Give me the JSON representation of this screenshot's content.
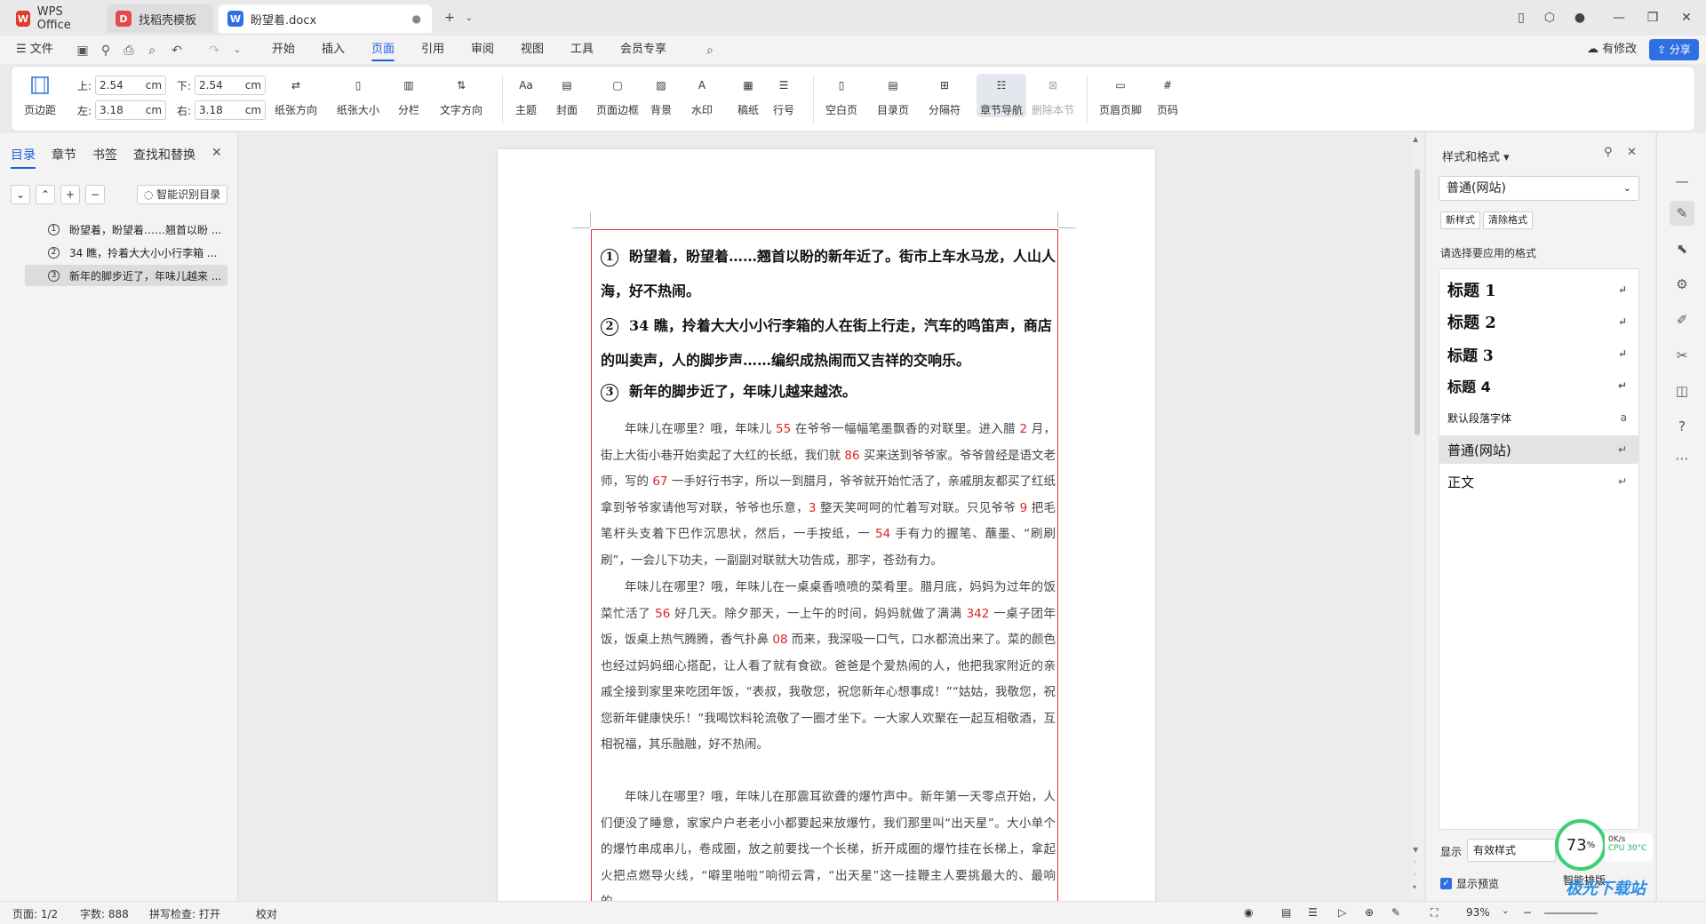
{
  "titlebar": {
    "tabs": [
      {
        "label": "WPS Office"
      },
      {
        "label": "找稻壳模板"
      },
      {
        "label": "盼望着.docx"
      }
    ],
    "new_tab": "+",
    "modified_label": "有修改",
    "share_label": "分享"
  },
  "menu": {
    "file": "文件",
    "items": [
      "开始",
      "插入",
      "页面",
      "引用",
      "审阅",
      "视图",
      "工具",
      "会员专享"
    ],
    "active": "页面"
  },
  "ribbon": {
    "margins_label": "页边距",
    "top_label": "上:",
    "top_value": "2.54",
    "bottom_label": "下:",
    "bottom_value": "2.54",
    "left_label": "左:",
    "left_value": "3.18",
    "right_label": "右:",
    "right_value": "3.18",
    "unit": "cm",
    "buttons": [
      "纸张方向",
      "纸张大小",
      "分栏",
      "文字方向",
      "主题",
      "封面",
      "页面边框",
      "背景",
      "水印",
      "稿纸",
      "行号",
      "空白页",
      "目录页",
      "分隔符",
      "章节导航",
      "删除本节",
      "页眉页脚",
      "页码"
    ]
  },
  "left_panel": {
    "tabs": [
      "目录",
      "章节",
      "书签",
      "查找和替换"
    ],
    "smart_toc_label": "智能识别目录",
    "toc_items": [
      {
        "num": "1",
        "text": "盼望着，盼望着……翘首以盼 ..."
      },
      {
        "num": "2",
        "text": "34 瞧，拎着大大小小行李箱 ..."
      },
      {
        "num": "3",
        "text": "新年的脚步近了，年味儿越来 ..."
      }
    ]
  },
  "document": {
    "headings": [
      {
        "num": "1",
        "text": "盼望着，盼望着……翘首以盼的新年近了。街市上车水马龙，人山人海，好不热闹。"
      },
      {
        "num": "2",
        "text": "34 瞧，拎着大大小小行李箱的人在街上行走，汽车的鸣笛声，商店的叫卖声，人的脚步声……编织成热闹而又吉祥的交响乐。"
      },
      {
        "num": "3",
        "text": "新年的脚步近了，年味儿越来越浓。"
      }
    ],
    "p1": [
      "年味儿在哪里？哦，年味儿 ",
      "55",
      " 在爷爷一幅幅笔墨飘香的对联里。进入腊 ",
      "2",
      " 月，街上大街小巷开始卖起了大红的长纸，我们就 ",
      "86",
      " 买来送到爷爷家。爷爷曾经是语文老师，写的 ",
      "67",
      " 一手好行书字，所以一到腊月，爷爷就开始忙活了，亲戚朋友都买了红纸拿到爷爷家请他写对联，爷爷也乐意，",
      "3",
      " 整天笑呵呵的忙着写对联。只见爷爷 ",
      "9",
      " 把毛笔杆头支着下巴作沉思状，然后，一手按纸，一 ",
      "54",
      " 手有力的握笔、蘸墨、“刷刷刷”，一会儿下功夫，一副副对联就大功告成，那字，苍劲有力。"
    ],
    "p2": [
      "年味儿在哪里？哦，年味儿在一桌桌香喷喷的菜肴里。腊月底，妈妈为过年的饭菜忙活了 ",
      "56",
      " 好几天。除夕那天，一上午的时间，妈妈就做了满满 ",
      "342",
      " 一桌子团年饭，饭桌上热气腾腾，香气扑鼻 ",
      "08",
      " 而来，我深吸一口气，口水都流出来了。菜的颜色也经过妈妈细心搭配，让人看了就有食欲。爸爸是个爱热闹的人，他把我家附近的亲戚全接到家里来吃团年饭，“表叔，我敬您，祝您新年心想事成！”“姑姑，我敬您，祝您新年健康快乐！”我喝饮料轮流敬了一圈才坐下。一大家人欢聚在一起互相敬酒，互相祝福，其乐融融，好不热闹。"
    ],
    "p3": [
      "年味儿在哪里？哦，年味儿在那震耳欲聋的爆竹声中。新年第一天零点开始，人们便没了睡意，家家户户老老小小都要起来放爆竹，我们那里叫“出天星”。大小单个的爆竹串成串儿，卷成圈，放之前要找一个长梯，折开成圈的爆竹挂在长梯上，拿起火把点燃导火线，“噼里啪啦”响彻云霄，“出天星”这一挂鞭主人要挑最大的、最响的，"
    ]
  },
  "right_panel": {
    "title": "样式和格式",
    "current_style": "普通(网站)",
    "new_style": "新样式",
    "clear_format": "清除格式",
    "prompt": "请选择要应用的格式",
    "styles": [
      {
        "name": "标题  1"
      },
      {
        "name": "标题  2"
      },
      {
        "name": "标题  3"
      },
      {
        "name": "标题  4"
      },
      {
        "name": "默认段落字体"
      },
      {
        "name": "普通(网站)"
      },
      {
        "name": "正文"
      }
    ],
    "show_label": "显示",
    "show_value": "有效样式",
    "preview_label": "显示预览",
    "smart_layout": "智能排版"
  },
  "perf_widget": {
    "percent": "73",
    "speed": "0K/s",
    "cpu": "CPU 30°C"
  },
  "statusbar": {
    "page": "页面: 1/2",
    "words": "字数: 888",
    "spell": "拼写检查: 打开",
    "proof": "校对",
    "zoom": "93%"
  },
  "watermark": "极光下载站"
}
